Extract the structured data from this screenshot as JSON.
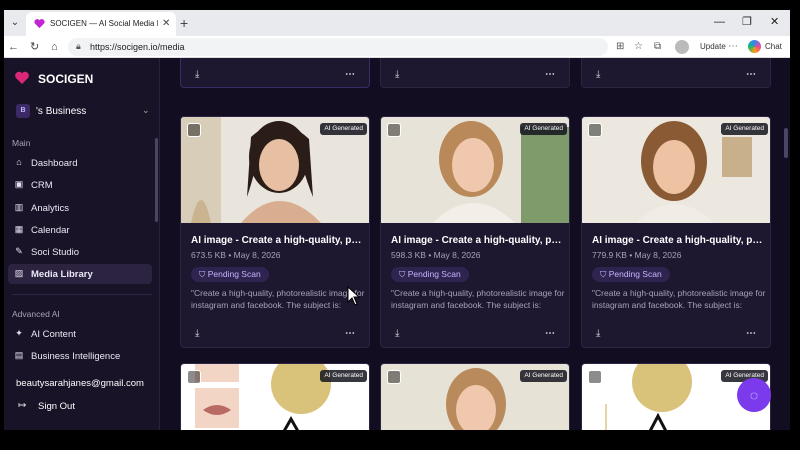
{
  "browser": {
    "tab_title": "SOCIGEN — AI Social Media Mana",
    "url": "https://socigen.io/media",
    "update_label": "Update",
    "chat_label": "Chat"
  },
  "sidebar": {
    "brand": "SOCIGEN",
    "business_initial": "B",
    "business_name": "'s Business",
    "main_label": "Main",
    "main_items": [
      {
        "label": "Dashboard",
        "icon": "home-icon"
      },
      {
        "label": "CRM",
        "icon": "crm-icon"
      },
      {
        "label": "Analytics",
        "icon": "chart-icon"
      },
      {
        "label": "Calendar",
        "icon": "calendar-icon"
      },
      {
        "label": "Soci Studio",
        "icon": "studio-icon"
      },
      {
        "label": "Media Library",
        "icon": "image-icon"
      }
    ],
    "advanced_label": "Advanced AI",
    "advanced_items": [
      {
        "label": "AI Content",
        "icon": "ai-content-icon"
      },
      {
        "label": "Business Intelligence",
        "icon": "bi-icon"
      }
    ],
    "email": "beautysarahjanes@gmail.com",
    "signout_label": "Sign Out"
  },
  "media": {
    "badge": "AI Generated",
    "cards": [
      {
        "title": "AI image - Create a high-quality, photorealistic image",
        "meta": "673.5 KB • May 8, 2026",
        "status": "Pending Scan",
        "description": "\"Create a high-quality, photorealistic image for instagram and facebook. The subject is:"
      },
      {
        "title": "AI image - Create a high-quality, photorealistic image",
        "meta": "598.3 KB • May 8, 2026",
        "status": "Pending Scan",
        "description": "\"Create a high-quality, photorealistic image for instagram and facebook. The subject is:"
      },
      {
        "title": "AI image - Create a high-quality, photorealistic image",
        "meta": "779.9 KB • May 8, 2026",
        "status": "Pending Scan",
        "description": "\"Create a high-quality, photorealistic image for instagram and facebook. The subject is:"
      }
    ]
  },
  "colors": {
    "accent": "#7c3aed",
    "sidebar_bg": "#191327",
    "app_bg": "#120d20"
  }
}
